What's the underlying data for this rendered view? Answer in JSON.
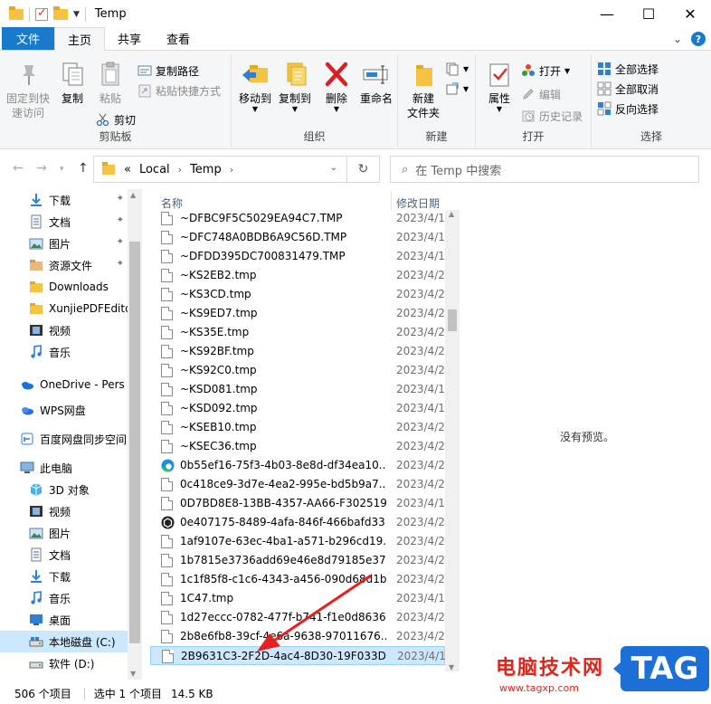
{
  "window": {
    "title": "Temp",
    "minimize": "—",
    "maximize": "☐",
    "close": "✕"
  },
  "tabs": [
    {
      "label": "文件",
      "kind": "file"
    },
    {
      "label": "主页",
      "kind": "active"
    },
    {
      "label": "共享",
      "kind": "normal"
    },
    {
      "label": "查看",
      "kind": "normal"
    }
  ],
  "ribbon": {
    "clipboard": {
      "label": "剪贴板",
      "pin": "固定到快\n速访问",
      "copy": "复制",
      "paste": "粘贴",
      "copy_path": "复制路径",
      "paste_shortcut": "粘贴快捷方式",
      "cut": "剪切"
    },
    "organize": {
      "label": "组织",
      "move_to": "移动到",
      "copy_to": "复制到",
      "delete": "删除",
      "rename": "重命名"
    },
    "new": {
      "label": "新建",
      "new_folder": "新建\n文件夹"
    },
    "open": {
      "label": "打开",
      "properties": "属性",
      "open": "打开",
      "edit": "编辑",
      "history": "历史记录"
    },
    "select": {
      "label": "选择",
      "select_all": "全部选择",
      "select_none": "全部取消",
      "invert": "反向选择"
    }
  },
  "address": {
    "prefix": "«",
    "crumbs": [
      "Local",
      "Temp"
    ],
    "search_placeholder": "在 Temp 中搜索"
  },
  "nav": [
    {
      "label": "下载",
      "icon": "download-icon",
      "pinned": true
    },
    {
      "label": "文档",
      "icon": "document-icon",
      "pinned": true
    },
    {
      "label": "图片",
      "icon": "pictures-icon",
      "pinned": true
    },
    {
      "label": "资源文件",
      "icon": "folder-special-icon",
      "pinned": true
    },
    {
      "label": "Downloads",
      "icon": "folder-icon",
      "pinned": false
    },
    {
      "label": "XunjiePDFEdito",
      "icon": "folder-icon",
      "pinned": false
    },
    {
      "label": "视频",
      "icon": "video-icon",
      "pinned": false
    },
    {
      "label": "音乐",
      "icon": "music-icon",
      "pinned": false
    },
    {
      "label": "OneDrive - Pers",
      "icon": "onedrive-icon",
      "pinned": false
    },
    {
      "label": "WPS网盘",
      "icon": "cloud-icon",
      "pinned": false
    },
    {
      "label": "百度网盘同步空间",
      "icon": "baidu-icon",
      "pinned": false
    },
    {
      "label": "此电脑",
      "icon": "computer-icon",
      "pinned": false
    },
    {
      "label": "3D 对象",
      "icon": "3d-icon",
      "pinned": false
    },
    {
      "label": "视频",
      "icon": "video-icon",
      "pinned": false
    },
    {
      "label": "图片",
      "icon": "pictures-icon",
      "pinned": false
    },
    {
      "label": "文档",
      "icon": "document-icon",
      "pinned": false
    },
    {
      "label": "下载",
      "icon": "download-icon",
      "pinned": false
    },
    {
      "label": "音乐",
      "icon": "music-icon",
      "pinned": false
    },
    {
      "label": "桌面",
      "icon": "desktop-icon",
      "pinned": false
    },
    {
      "label": "本地磁盘 (C:)",
      "icon": "drive-c-icon",
      "pinned": false,
      "selected": true
    },
    {
      "label": "软件 (D:)",
      "icon": "drive-icon",
      "pinned": false
    }
  ],
  "columns": {
    "name": "名称",
    "date": "修改日期"
  },
  "files": [
    {
      "name": "~DFBC9F5C5029EA94C7.TMP",
      "date": "2023/4/1"
    },
    {
      "name": "~DFC748A0BDB6A9C56D.TMP",
      "date": "2023/4/1"
    },
    {
      "name": "~DFDD395DC700831479.TMP",
      "date": "2023/4/1"
    },
    {
      "name": "~KS2EB2.tmp",
      "date": "2023/4/2"
    },
    {
      "name": "~KS3CD.tmp",
      "date": "2023/4/2"
    },
    {
      "name": "~KS9ED7.tmp",
      "date": "2023/4/2"
    },
    {
      "name": "~KS35E.tmp",
      "date": "2023/4/2"
    },
    {
      "name": "~KS92BF.tmp",
      "date": "2023/4/2"
    },
    {
      "name": "~KS92C0.tmp",
      "date": "2023/4/2"
    },
    {
      "name": "~KSD081.tmp",
      "date": "2023/4/1"
    },
    {
      "name": "~KSD092.tmp",
      "date": "2023/4/1"
    },
    {
      "name": "~KSEB10.tmp",
      "date": "2023/4/2"
    },
    {
      "name": "~KSEC36.tmp",
      "date": "2023/4/2"
    },
    {
      "name": "0b55ef16-75f3-4b03-8e8d-df34ea10...",
      "date": "2023/4/2",
      "icon": "edge"
    },
    {
      "name": "0c418ce9-3d7e-4ea2-995e-bd5b9a7...",
      "date": "2023/4/2"
    },
    {
      "name": "0D7BD8E8-13BB-4357-AA66-F302519...",
      "date": "2023/4/1"
    },
    {
      "name": "0e407175-8489-4afa-846f-466bafd33...",
      "date": "2023/4/2",
      "icon": "unity"
    },
    {
      "name": "1af9107e-63ec-4ba1-a571-b296cd19...",
      "date": "2023/4/2"
    },
    {
      "name": "1b7815e3736add69e46e8d79185e37...",
      "date": "2023/4/2"
    },
    {
      "name": "1c1f85f8-c1c6-4343-a456-090d68d1b...",
      "date": "2023/4/2"
    },
    {
      "name": "1C47.tmp",
      "date": "2023/4/1"
    },
    {
      "name": "1d27eccc-0782-477f-b741-f1e0d8636...",
      "date": "2023/4/2"
    },
    {
      "name": "2b8e6fb8-39cf-4e6a-9638-97011676...",
      "date": "2023/4/2"
    },
    {
      "name": "2B9631C3-2F2D-4ac4-8D30-19F033D...",
      "date": "2023/4/1",
      "selected": true
    }
  ],
  "preview": {
    "message": "没有预览。"
  },
  "status": {
    "count": "506 个项目",
    "selection": "选中 1 个项目",
    "size": "14.5 KB"
  },
  "watermark": {
    "text": "电脑技术网",
    "url": "www.tagxp.com",
    "tag": "TAG"
  },
  "colors": {
    "accent": "#1979ca",
    "selection": "#cce8ff",
    "arrow": "#e62020",
    "watermark_red": "#e2231a",
    "watermark_blue": "#1c6fd6"
  }
}
